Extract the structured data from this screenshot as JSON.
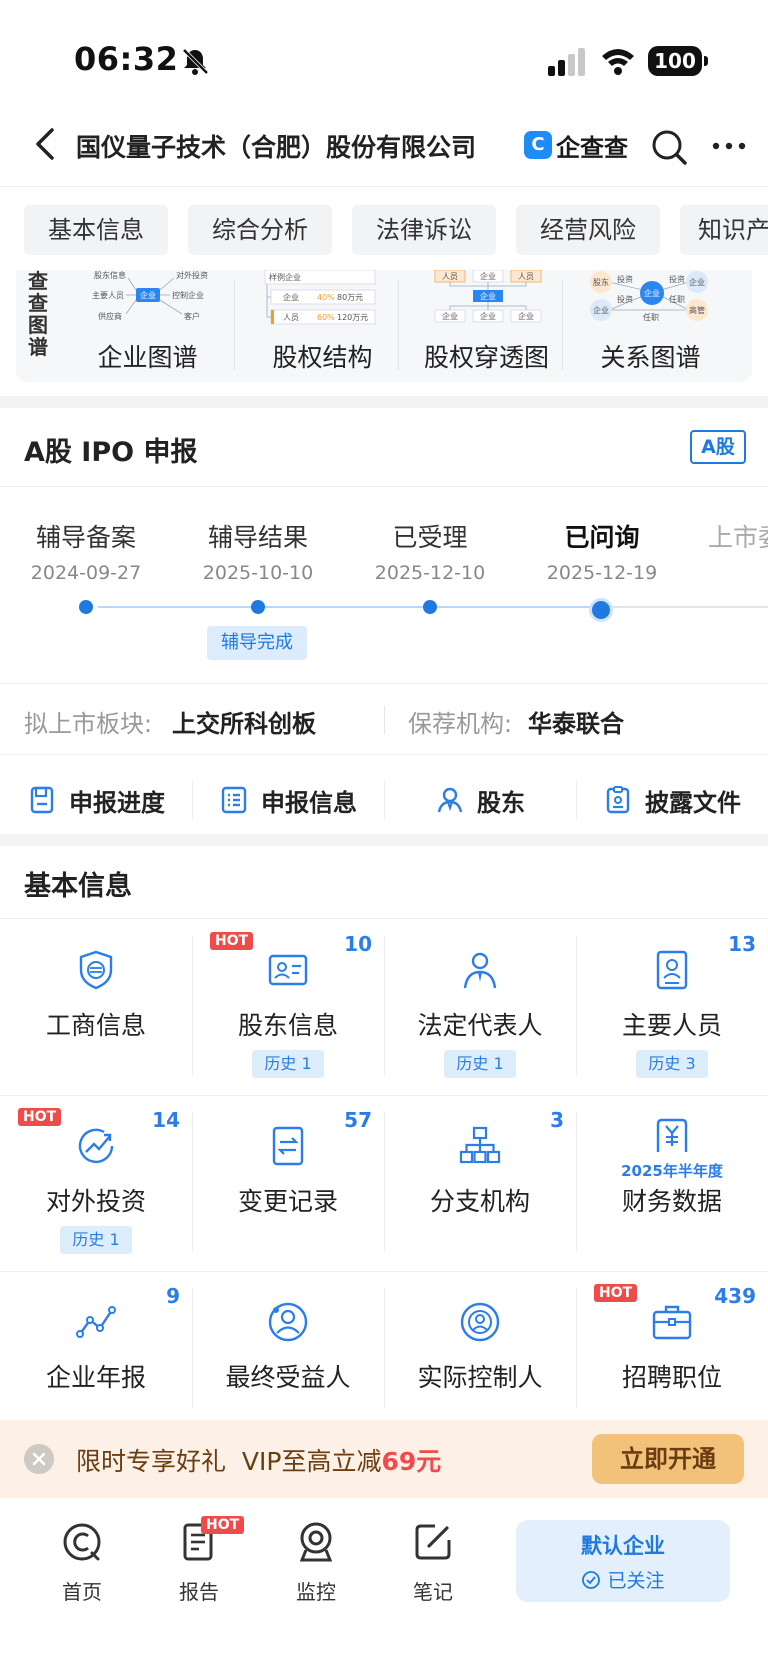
{
  "status_bar": {
    "time": "06:32",
    "battery": "100"
  },
  "header": {
    "title": "国仪量子技术（合肥）股份有限公司",
    "brand_logo": "C",
    "brand_name": "企查查"
  },
  "tabs": [
    "基本信息",
    "综合分析",
    "法律诉讼",
    "经营风险",
    "知识产权"
  ],
  "graph_card": {
    "side_label": [
      "查",
      "查",
      "图",
      "谱"
    ],
    "items": [
      {
        "label": "企业图谱",
        "thumb": [
          "股东信息",
          "对外投资",
          "主要人员",
          "企业",
          "控制企业",
          "供应商",
          "客户"
        ]
      },
      {
        "label": "股权结构",
        "thumb": [
          "样例企业",
          "企业",
          "40%",
          "80万元",
          "人员",
          "60%",
          "120万元"
        ]
      },
      {
        "label": "股权穿透图",
        "thumb": [
          "人员",
          "企业",
          "人员",
          "企业",
          "企业",
          "企业",
          "企业"
        ]
      },
      {
        "label": "关系图谱",
        "thumb": [
          "股东",
          "投资",
          "投资",
          "企业",
          "企业",
          "投资",
          "任职",
          "企业",
          "高管",
          "任职"
        ]
      }
    ]
  },
  "ipo": {
    "title": "A股 IPO 申报",
    "badge": "A股",
    "steps": [
      {
        "label": "辅导备案",
        "date": "2024-09-27"
      },
      {
        "label": "辅导结果",
        "date": "2025-10-10"
      },
      {
        "label": "已受理",
        "date": "2025-12-10"
      },
      {
        "label": "已问询",
        "date": "2025-12-19"
      },
      {
        "label": "上市委",
        "date": ""
      }
    ],
    "step_tag": "辅导完成",
    "board_label": "拟上市板块:",
    "board_value": "上交所科创板",
    "sponsor_label": "保荐机构:",
    "sponsor_value": "华泰联合",
    "actions": [
      "申报进度",
      "申报信息",
      "股东",
      "披露文件"
    ]
  },
  "basic": {
    "title": "基本信息",
    "cells": [
      {
        "label": "工商信息",
        "icon": "shield-icon"
      },
      {
        "label": "股东信息",
        "icon": "id-card-icon",
        "hot": "HOT",
        "count": "10",
        "history": "历史 1"
      },
      {
        "label": "法定代表人",
        "icon": "person-tie-icon",
        "history": "历史 1"
      },
      {
        "label": "主要人员",
        "icon": "badge-person-icon",
        "count": "13",
        "history": "历史 3"
      },
      {
        "label": "对外投资",
        "icon": "trend-up-icon",
        "hot": "HOT",
        "count": "14",
        "history": "历史 1"
      },
      {
        "label": "变更记录",
        "icon": "swap-doc-icon",
        "count": "57"
      },
      {
        "label": "分支机构",
        "icon": "org-chart-icon",
        "count": "3"
      },
      {
        "label": "财务数据",
        "icon": "yuan-doc-icon",
        "year_tag": "2025年半年度"
      },
      {
        "label": "企业年报",
        "icon": "line-chart-icon",
        "count": "9"
      },
      {
        "label": "最终受益人",
        "icon": "beneficiary-icon"
      },
      {
        "label": "实际控制人",
        "icon": "controller-icon"
      },
      {
        "label": "招聘职位",
        "icon": "briefcase-icon",
        "hot": "HOT",
        "count": "439"
      }
    ]
  },
  "promo": {
    "text": "限时专享好礼  VIP至高立减",
    "amount": "69元",
    "button": "立即开通"
  },
  "bottom_nav": {
    "items": [
      {
        "label": "首页"
      },
      {
        "label": "报告",
        "hot": "HOT"
      },
      {
        "label": "监控"
      },
      {
        "label": "笔记"
      }
    ],
    "follow_title": "默认企业",
    "follow_sub": "已关注"
  },
  "colors": {
    "accent": "#1f7ae0",
    "hot": "#f04b4b",
    "promo_bg": "#fdf0e6",
    "promo_button": "#f2c27a"
  }
}
